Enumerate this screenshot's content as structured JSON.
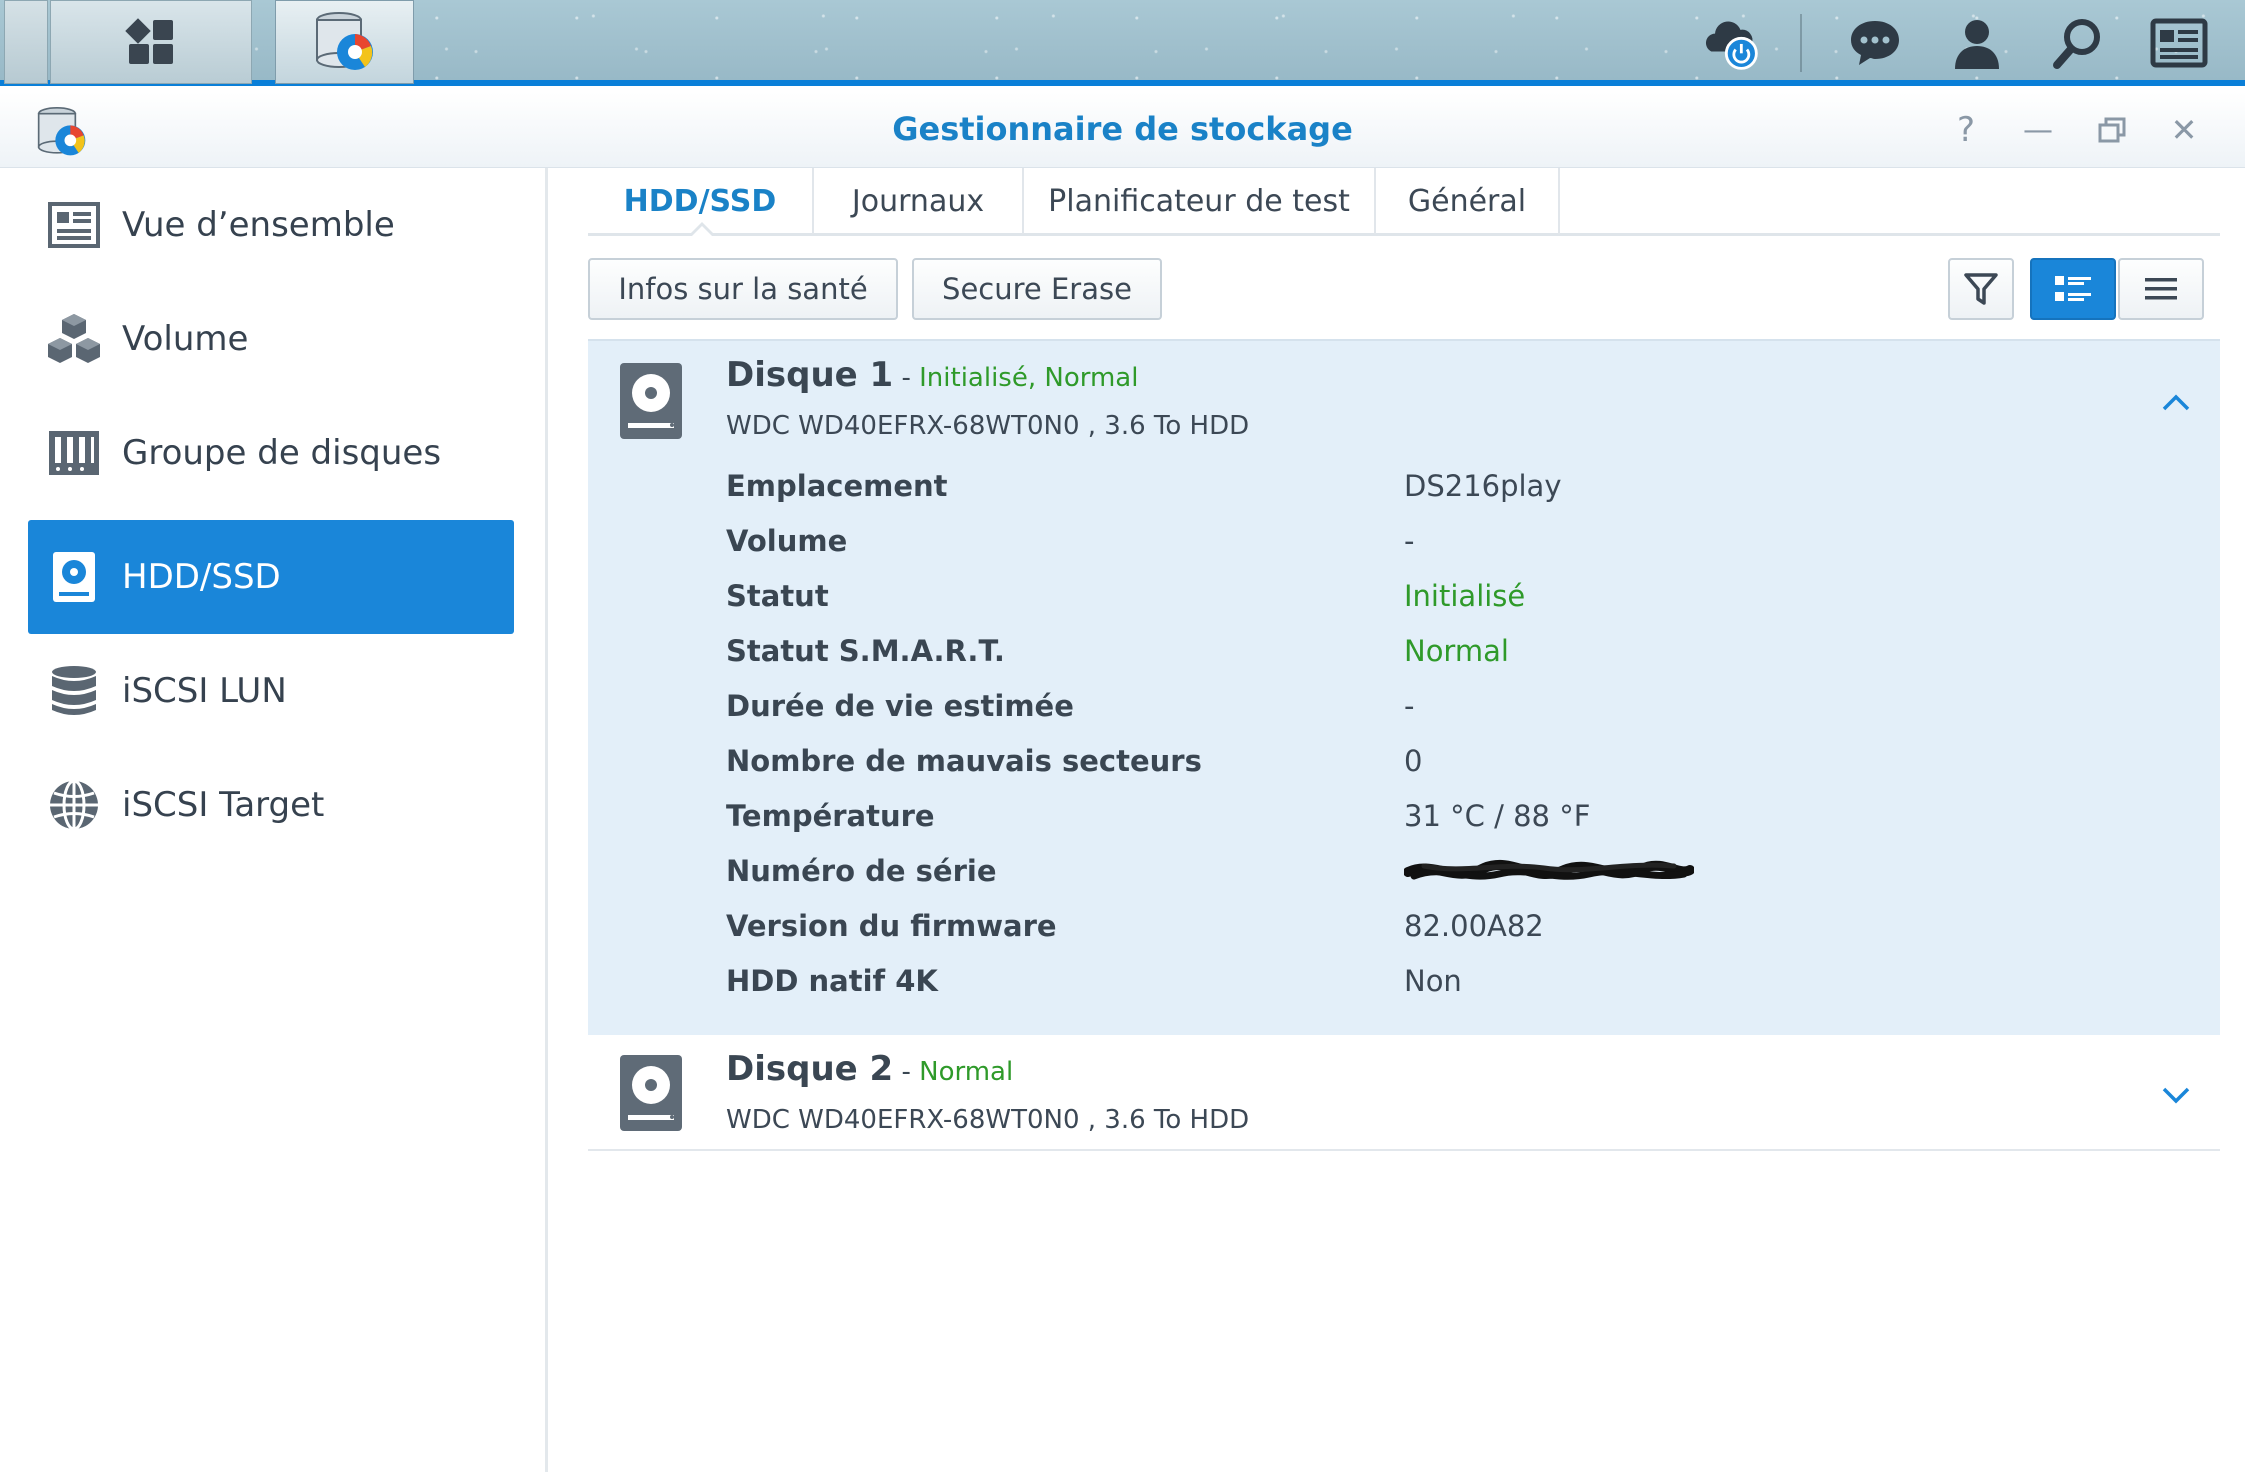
{
  "taskbar": {
    "icons": [
      "show-desktop",
      "main-menu-grid-icon",
      "storage-manager-app-icon",
      "cloud-power-icon",
      "chat-icon",
      "user-icon",
      "search-icon",
      "widgets-icon"
    ]
  },
  "window": {
    "title": "Gestionnaire de stockage",
    "controls": [
      "help-icon",
      "minimize-icon",
      "restore-icon",
      "close-icon"
    ],
    "help_glyph": "?",
    "minimize_glyph": "—",
    "close_glyph": "✕"
  },
  "sidebar": {
    "items": [
      {
        "label": "Vue d’ensemble",
        "icon": "overview-icon",
        "active": false
      },
      {
        "label": "Volume",
        "icon": "volume-cubes-icon",
        "active": false
      },
      {
        "label": "Groupe de disques",
        "icon": "disk-group-icon",
        "active": false
      },
      {
        "label": "HDD/SSD",
        "icon": "hdd-icon",
        "active": true
      },
      {
        "label": "iSCSI LUN",
        "icon": "database-icon",
        "active": false
      },
      {
        "label": "iSCSI Target",
        "icon": "globe-icon",
        "active": false
      }
    ]
  },
  "tabs": [
    {
      "label": "HDD/SSD",
      "active": true
    },
    {
      "label": "Journaux",
      "active": false
    },
    {
      "label": "Planificateur de test",
      "active": false
    },
    {
      "label": "Général",
      "active": false
    }
  ],
  "toolbar": {
    "health_label": "Infos sur la santé",
    "erase_label": "Secure Erase",
    "view_icons": [
      "filter-icon",
      "detail-view-icon",
      "list-view-icon"
    ],
    "active_view": "detail-view-icon"
  },
  "disks": [
    {
      "name": "Disque 1",
      "separator": " - ",
      "status": "Initialisé, Normal",
      "model": "WDC WD40EFRX-68WT0N0 , 3.6 To HDD",
      "expanded": true,
      "details": [
        {
          "label": "Emplacement",
          "value": "DS216play",
          "color": "normal"
        },
        {
          "label": "Volume",
          "value": "-",
          "color": "normal"
        },
        {
          "label": "Statut",
          "value": "Initialisé",
          "color": "green"
        },
        {
          "label": "Statut S.M.A.R.T.",
          "value": "Normal",
          "color": "green"
        },
        {
          "label": "Durée de vie estimée",
          "value": "-",
          "color": "normal"
        },
        {
          "label": "Nombre de mauvais secteurs",
          "value": "0",
          "color": "normal"
        },
        {
          "label": "Température",
          "value": "31 °C / 88 °F",
          "color": "normal"
        },
        {
          "label": "Numéro de série",
          "value": "",
          "color": "redacted"
        },
        {
          "label": "Version du firmware",
          "value": "82.00A82",
          "color": "normal"
        },
        {
          "label": "HDD natif 4K",
          "value": "Non",
          "color": "normal"
        }
      ]
    },
    {
      "name": "Disque 2",
      "separator": " - ",
      "status": "Normal",
      "model": "WDC WD40EFRX-68WT0N0 , 3.6 To HDD",
      "expanded": false
    }
  ],
  "colors": {
    "accent": "#1a86d9",
    "title_blue": "#1a82c7",
    "status_green": "#2f9a2a",
    "expanded_bg": "#e3eff9"
  }
}
